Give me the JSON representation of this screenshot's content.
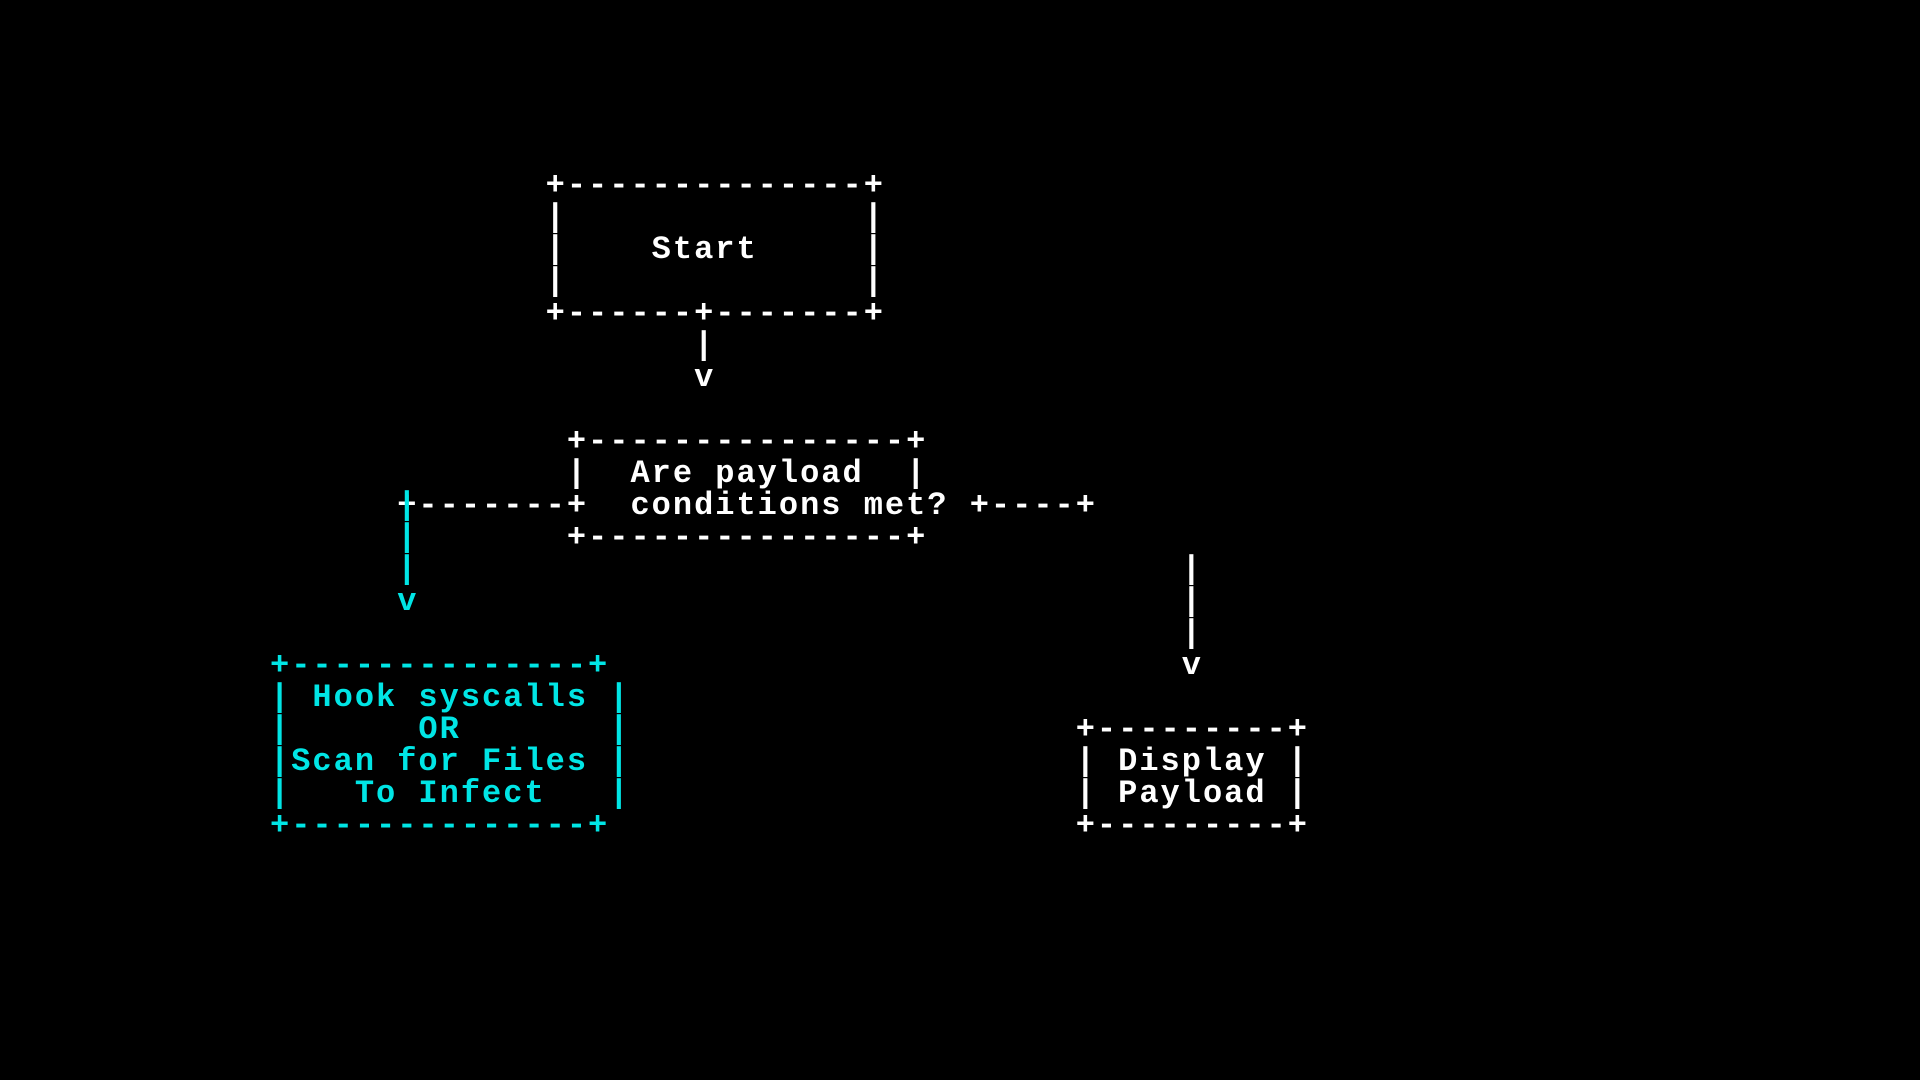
{
  "diagram": {
    "colors": {
      "bg": "#000000",
      "white": "#ffffff",
      "cyan": "#00e5e5"
    },
    "start": {
      "border_top": "             +--------------+",
      "pad1": "             |              |",
      "label": "             |    Start     |",
      "pad2": "             |              |",
      "border_bot": "             +------+-------+",
      "arrow1": "                    |",
      "arrow2": "                    v"
    },
    "decision": {
      "border_top": "              +---------------+",
      "line1": "              |  Are payload  |",
      "line2_left": "+-------+  conditions met? +----+",
      "border_bot": "              +---------------+",
      "left_drop1_c": "|",
      "left_drop2_c": "|",
      "left_drop3_c": "|",
      "left_arrow_c": "v",
      "right_col": "                                           |",
      "right_col2": "                                           |",
      "right_col3": "                                           |",
      "right_arrow": "                                           v"
    },
    "left_box": {
      "top": "+--------------+",
      "l1": "| Hook syscalls |",
      "l2": "|      OR       |",
      "l3": "|Scan for Files |",
      "l4": "|   To Infect   |",
      "bot": "+--------------+"
    },
    "right_box": {
      "top": "+---------+",
      "l1": "| Display |",
      "l2": "| Payload |",
      "bot": "+---------+"
    }
  }
}
